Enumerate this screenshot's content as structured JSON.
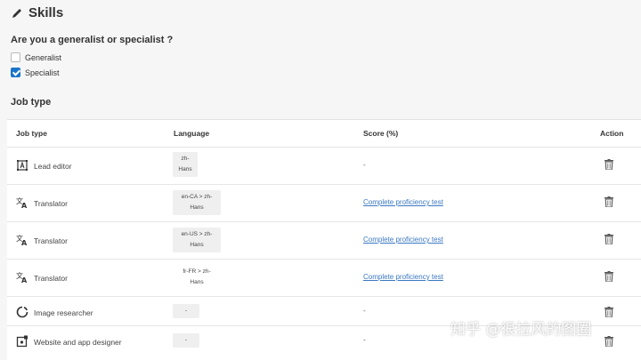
{
  "header": {
    "title": "Skills",
    "icon": "pencil-icon"
  },
  "question": "Are you a generalist or specialist ?",
  "options": [
    {
      "label": "Generalist",
      "checked": false
    },
    {
      "label": "Specialist",
      "checked": true
    }
  ],
  "section_title": "Job type",
  "table": {
    "headers": {
      "job_type": "Job type",
      "language": "Language",
      "score": "Score (%)",
      "action": "Action"
    },
    "rows": [
      {
        "job": "Lead editor",
        "icon": "lead-editor-icon",
        "language_line1": "zh-",
        "language_line2": "Hans",
        "score": "-"
      },
      {
        "job": "Translator",
        "icon": "translate-icon",
        "language_line1": "en-CA > zh-",
        "language_line2": "Hans",
        "score": "Complete proficiency test"
      },
      {
        "job": "Translator",
        "icon": "translate-icon",
        "language_line1": "en-US > zh-",
        "language_line2": "Hans",
        "score": "Complete proficiency test"
      },
      {
        "job": "Translator",
        "icon": "translate-icon",
        "language_line1": "fr-FR > zh-",
        "language_line2": "Hans",
        "score": "Complete proficiency test"
      },
      {
        "job": "Image researcher",
        "icon": "image-researcher-icon",
        "language_line1": "-",
        "score": "-"
      },
      {
        "job": "Website and app designer",
        "icon": "designer-icon",
        "language_line1": "-",
        "score": "-"
      }
    ]
  },
  "watermark": "知乎 @很拉风的图圈",
  "colors": {
    "link": "#3b78c3",
    "checkbox": "#1b74c7",
    "highlight": "#f9fb1e"
  }
}
